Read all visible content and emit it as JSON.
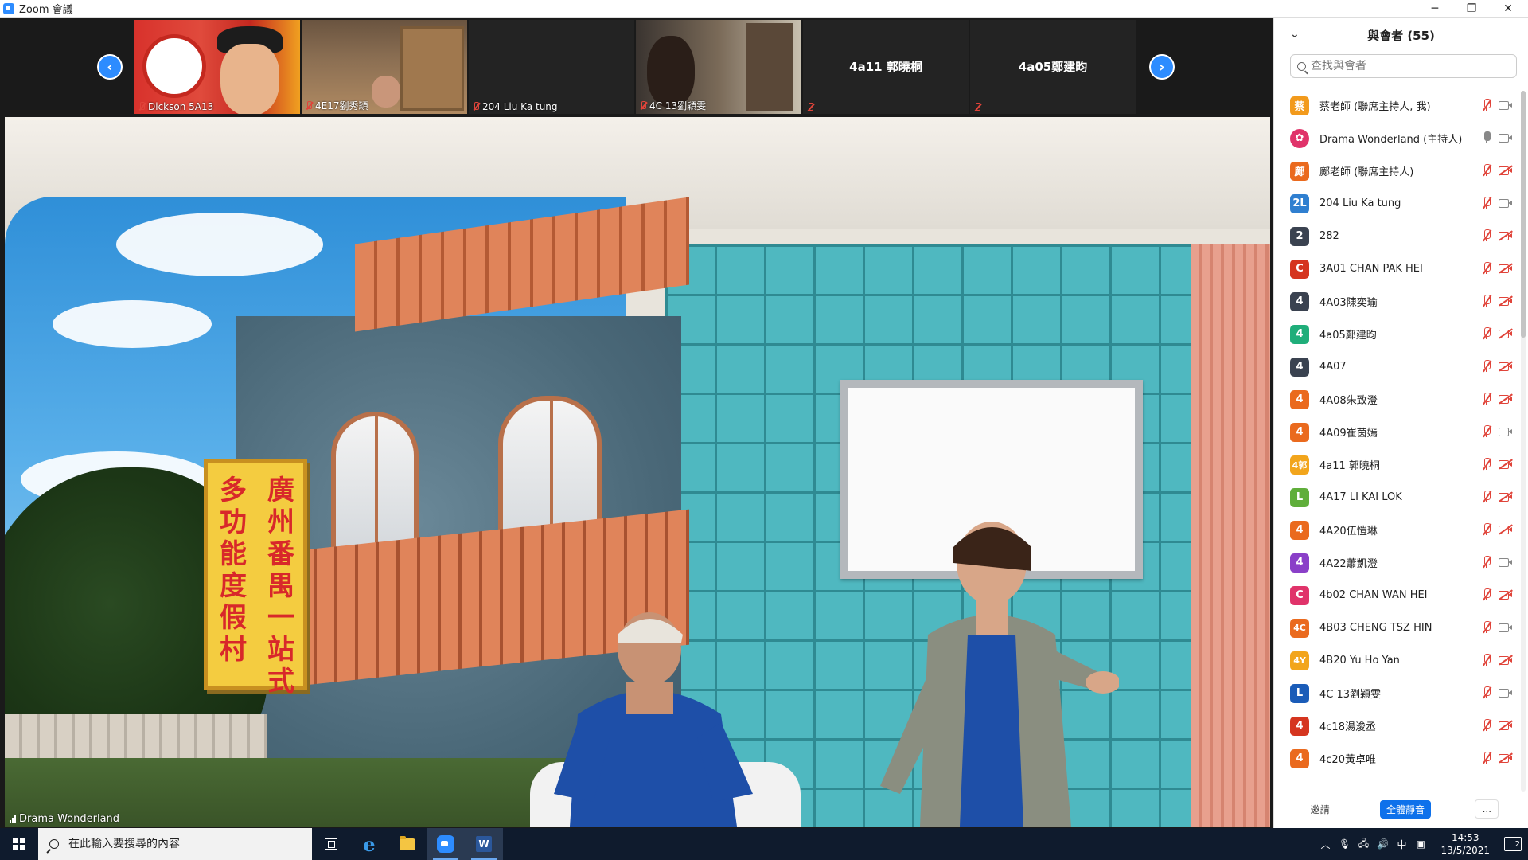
{
  "window": {
    "title": "Zoom 會議",
    "minimize": "─",
    "restore": "❐",
    "close": "✕"
  },
  "strip": {
    "prev_arrow": "‹",
    "next_arrow": "›",
    "thumbnails": [
      {
        "name": "Dickson 5A13",
        "has_video": true
      },
      {
        "name": "4E17劉秀穎",
        "has_video": true
      },
      {
        "name": "204 Liu Ka tung",
        "has_video": false
      },
      {
        "name": "4C 13劉穎雯",
        "has_video": true
      },
      {
        "name": "4a11 郭曉桐",
        "has_video": false
      },
      {
        "name": "4a05鄭建昀",
        "has_video": false
      }
    ]
  },
  "stage": {
    "active_speaker": "Drama Wonderland",
    "sign_col1": "廣州番禺一站式",
    "sign_col2": "多功能度假村"
  },
  "panel": {
    "title": "與會者 (55)",
    "collapse_icon": "⌄",
    "search_placeholder": "查找與會者",
    "participants": [
      {
        "initial": "蔡",
        "name": "蔡老師 (聯席主持人, 我)",
        "color": "#f29a1c",
        "mic": "muted",
        "cam": "on"
      },
      {
        "initial": "",
        "name": "Drama Wonderland (主持人)",
        "color": "#e0336a",
        "mic": "live",
        "cam": "on"
      },
      {
        "initial": "鄺",
        "name": "鄺老師 (聯席主持人)",
        "color": "#ea6a1e",
        "mic": "muted",
        "cam": "off"
      },
      {
        "initial": "2L",
        "name": "204 Liu Ka tung",
        "color": "#2f7fd0",
        "mic": "muted",
        "cam": "on"
      },
      {
        "initial": "2",
        "name": "282",
        "color": "#3a4250",
        "mic": "muted",
        "cam": "off"
      },
      {
        "initial": "C",
        "name": "3A01 CHAN PAK HEI",
        "color": "#d5351f",
        "mic": "muted",
        "cam": "off"
      },
      {
        "initial": "4",
        "name": "4A03陳奕瑜",
        "color": "#3a4250",
        "mic": "muted",
        "cam": "off"
      },
      {
        "initial": "4",
        "name": "4a05鄭建昀",
        "color": "#1fae7a",
        "mic": "muted",
        "cam": "off"
      },
      {
        "initial": "4",
        "name": "4A07",
        "color": "#3a4250",
        "mic": "muted",
        "cam": "off"
      },
      {
        "initial": "4",
        "name": "4A08朱致澄",
        "color": "#ea6a1e",
        "mic": "muted",
        "cam": "off"
      },
      {
        "initial": "4",
        "name": "4A09崔茵嫣",
        "color": "#ea6a1e",
        "mic": "muted",
        "cam": "on"
      },
      {
        "initial": "4郭",
        "name": "4a11 郭曉桐",
        "color": "#f2a51c",
        "mic": "muted",
        "cam": "off"
      },
      {
        "initial": "L",
        "name": "4A17 LI KAI LOK",
        "color": "#5fae3a",
        "mic": "muted",
        "cam": "off"
      },
      {
        "initial": "4",
        "name": "4A20伍愷琳",
        "color": "#ea6a1e",
        "mic": "muted",
        "cam": "off"
      },
      {
        "initial": "4",
        "name": "4A22蕭凱澄",
        "color": "#8a3fc8",
        "mic": "muted",
        "cam": "on"
      },
      {
        "initial": "C",
        "name": "4b02 CHAN WAN HEI",
        "color": "#e0336a",
        "mic": "muted",
        "cam": "off"
      },
      {
        "initial": "4C",
        "name": "4B03 CHENG TSZ HIN",
        "color": "#ea6a1e",
        "mic": "muted",
        "cam": "on"
      },
      {
        "initial": "4Y",
        "name": "4B20 Yu Ho Yan",
        "color": "#f2a51c",
        "mic": "muted",
        "cam": "off"
      },
      {
        "initial": "L",
        "name": "4C 13劉穎雯",
        "color": "#1a5cb8",
        "mic": "muted",
        "cam": "on"
      },
      {
        "initial": "4",
        "name": "4c18湯浚丞",
        "color": "#d5351f",
        "mic": "muted",
        "cam": "off"
      },
      {
        "initial": "4",
        "name": "4c20黃卓唯",
        "color": "#ea6a1e",
        "mic": "muted",
        "cam": "off"
      }
    ],
    "footer": {
      "invite": "邀請",
      "mute_all": "全體靜音",
      "more": "..."
    }
  },
  "taskbar": {
    "search_placeholder": "在此輸入要搜尋的內容",
    "tray_chevron": "︿",
    "ime": "中",
    "time": "14:53",
    "date": "13/5/2021",
    "notification_count": "2"
  }
}
